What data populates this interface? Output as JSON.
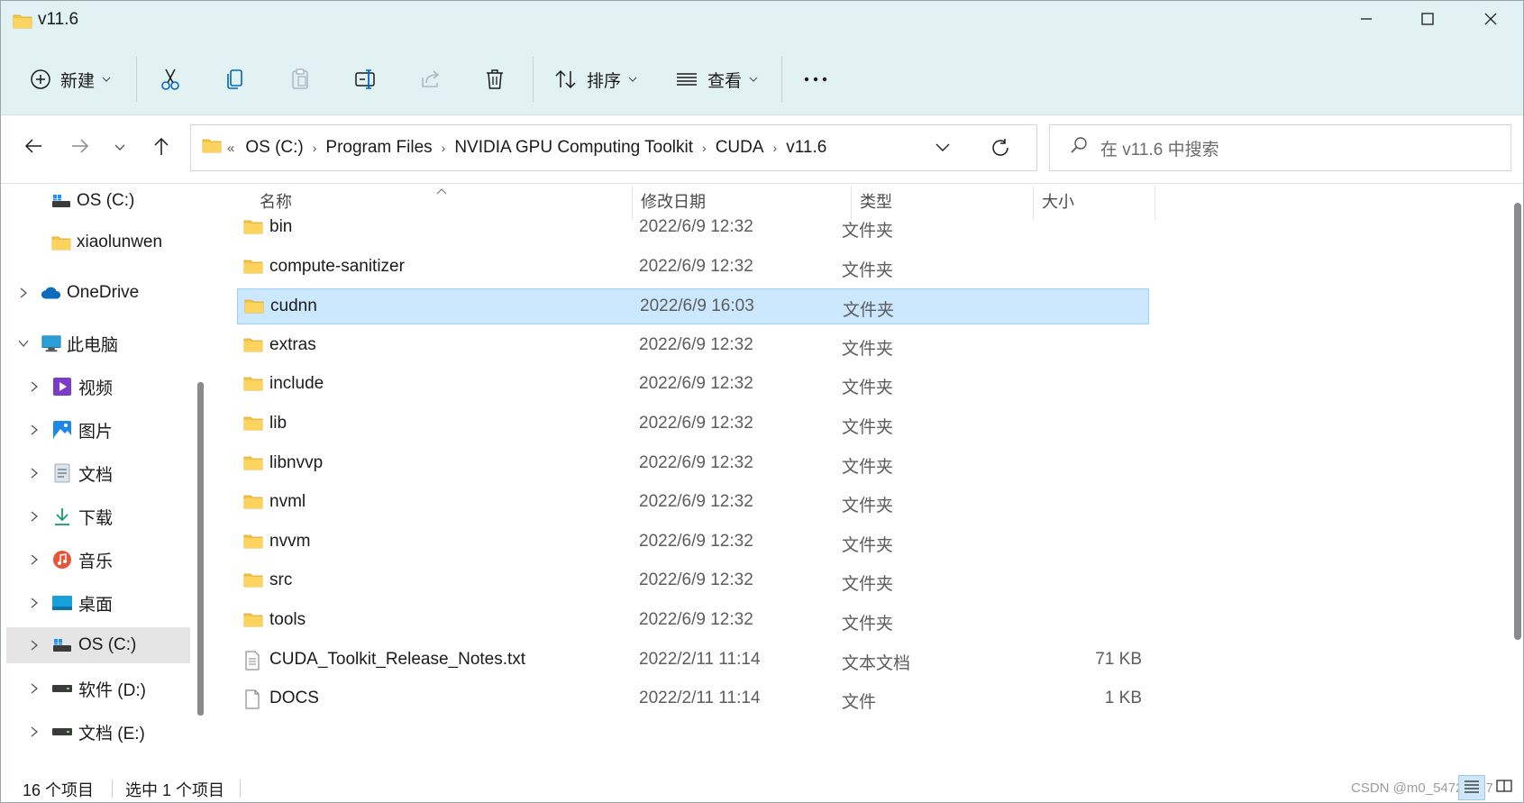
{
  "window": {
    "title": "v11.6"
  },
  "colors": {
    "accent": "#cce8ff",
    "titlebar": "#e2f2f2",
    "folder": "#f8c444"
  },
  "toolbar": {
    "new_label": "新建",
    "sort_label": "排序",
    "view_label": "查看",
    "more_label": "...",
    "icons": [
      "add-circle-icon",
      "cut-icon",
      "copy-icon",
      "paste-icon",
      "rename-icon",
      "share-icon",
      "delete-icon",
      "sort-icon",
      "view-icon",
      "more-icon"
    ]
  },
  "address": {
    "overflow": "«",
    "crumbs": [
      "OS (C:)",
      "Program Files",
      "NVIDIA GPU Computing Toolkit",
      "CUDA",
      "v11.6"
    ]
  },
  "search": {
    "placeholder": "在 v11.6 中搜索"
  },
  "sidebar": {
    "items": [
      {
        "label": "OS (C:)",
        "icon": "drive-c-icon"
      },
      {
        "label": "xiaolunwen",
        "icon": "folder-icon"
      },
      {
        "label": "OneDrive",
        "icon": "onedrive-icon"
      },
      {
        "label": "此电脑",
        "icon": "this-pc-icon"
      },
      {
        "label": "视频",
        "icon": "videos-icon"
      },
      {
        "label": "图片",
        "icon": "pictures-icon"
      },
      {
        "label": "文档",
        "icon": "documents-icon"
      },
      {
        "label": "下载",
        "icon": "downloads-icon"
      },
      {
        "label": "音乐",
        "icon": "music-icon"
      },
      {
        "label": "桌面",
        "icon": "desktop-icon"
      },
      {
        "label": "OS (C:)",
        "icon": "drive-c-icon"
      },
      {
        "label": "软件 (D:)",
        "icon": "drive-icon"
      },
      {
        "label": "文档 (E:)",
        "icon": "drive-icon"
      }
    ]
  },
  "columns": {
    "name": "名称",
    "date": "修改日期",
    "type": "类型",
    "size": "大小"
  },
  "files": [
    {
      "name": "bin",
      "date": "2022/6/9 12:32",
      "type": "文件夹",
      "size": "",
      "icon": "folder-icon"
    },
    {
      "name": "compute-sanitizer",
      "date": "2022/6/9 12:32",
      "type": "文件夹",
      "size": "",
      "icon": "folder-icon"
    },
    {
      "name": "cudnn",
      "date": "2022/6/9 16:03",
      "type": "文件夹",
      "size": "",
      "icon": "folder-icon",
      "selected": true
    },
    {
      "name": "extras",
      "date": "2022/6/9 12:32",
      "type": "文件夹",
      "size": "",
      "icon": "folder-icon"
    },
    {
      "name": "include",
      "date": "2022/6/9 12:32",
      "type": "文件夹",
      "size": "",
      "icon": "folder-icon"
    },
    {
      "name": "lib",
      "date": "2022/6/9 12:32",
      "type": "文件夹",
      "size": "",
      "icon": "folder-icon"
    },
    {
      "name": "libnvvp",
      "date": "2022/6/9 12:32",
      "type": "文件夹",
      "size": "",
      "icon": "folder-icon"
    },
    {
      "name": "nvml",
      "date": "2022/6/9 12:32",
      "type": "文件夹",
      "size": "",
      "icon": "folder-icon"
    },
    {
      "name": "nvvm",
      "date": "2022/6/9 12:32",
      "type": "文件夹",
      "size": "",
      "icon": "folder-icon"
    },
    {
      "name": "src",
      "date": "2022/6/9 12:32",
      "type": "文件夹",
      "size": "",
      "icon": "folder-icon"
    },
    {
      "name": "tools",
      "date": "2022/6/9 12:32",
      "type": "文件夹",
      "size": "",
      "icon": "folder-icon"
    },
    {
      "name": "CUDA_Toolkit_Release_Notes.txt",
      "date": "2022/2/11 11:14",
      "type": "文本文档",
      "size": "71 KB",
      "icon": "text-file-icon"
    },
    {
      "name": "DOCS",
      "date": "2022/2/11 11:14",
      "type": "文件",
      "size": "1 KB",
      "icon": "file-icon"
    }
  ],
  "status": {
    "count": "16 个项目",
    "selection": "选中 1 个项目"
  },
  "watermark": "CSDN @m0_54728327"
}
